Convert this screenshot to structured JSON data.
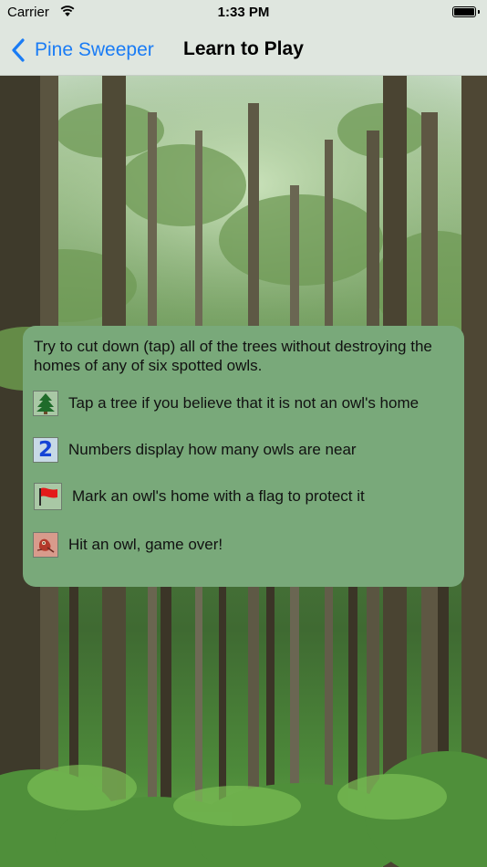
{
  "status_bar": {
    "carrier": "Carrier",
    "time": "1:33 PM",
    "wifi_icon": "wifi-icon",
    "battery_icon": "battery-icon"
  },
  "nav": {
    "back_label": "Pine Sweeper",
    "title": "Learn to Play"
  },
  "instructions": {
    "intro": "Try to cut down (tap) all of the trees without destroying the homes of any of six spotted owls.",
    "rules": [
      {
        "icon": "tree-icon",
        "text": "Tap a tree if you believe that it is not an owl's home"
      },
      {
        "icon": "number-icon",
        "glyph": "2",
        "text": "Numbers display how many owls are near"
      },
      {
        "icon": "flag-icon",
        "text": "Mark an owl's home with a flag to protect it"
      },
      {
        "icon": "owl-icon",
        "text": "Hit an owl, game over!"
      }
    ]
  },
  "colors": {
    "accent": "#1a7cf5",
    "bar": "#dfe6df",
    "card": "#79a97a"
  }
}
